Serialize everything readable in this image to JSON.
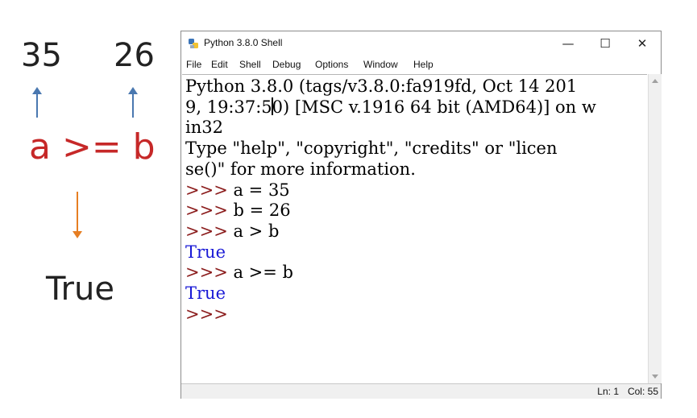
{
  "annotation": {
    "a_value": "35",
    "b_value": "26",
    "expression": "a >= b",
    "result": "True",
    "colors": {
      "expression": "#c62828",
      "up_arrow": "#4a78b0",
      "down_arrow": "#e67e22"
    }
  },
  "window": {
    "title": "Python 3.8.0 Shell",
    "icon": "python-icon",
    "controls": {
      "minimize": "—",
      "maximize": "☐",
      "close": "✕"
    }
  },
  "menu": [
    "File",
    "Edit",
    "Shell",
    "Debug",
    "Options",
    "Window",
    "Help"
  ],
  "shell": {
    "banner_line1": "Python 3.8.0 (tags/v3.8.0:fa919fd, Oct 14 201",
    "banner_line2_a": "9, 19:37:5",
    "banner_line2_b": "0) [MSC v.1916 64 bit (AMD64)] on w",
    "banner_line3": "in32",
    "banner_line4": "Type \"help\", \"copyright\", \"credits\" or \"licen",
    "banner_line5": "se()\" for more information.",
    "prompt": ">>>",
    "cmd1": " a = 35",
    "cmd2": " b = 26",
    "cmd3": " a > b",
    "out1": "True",
    "cmd4": " a >= b",
    "out2": "True",
    "colors": {
      "prompt": "#8b1c1c",
      "output": "#1a1ad6"
    }
  },
  "status": {
    "line": "Ln: 1",
    "col": "Col: 55"
  }
}
